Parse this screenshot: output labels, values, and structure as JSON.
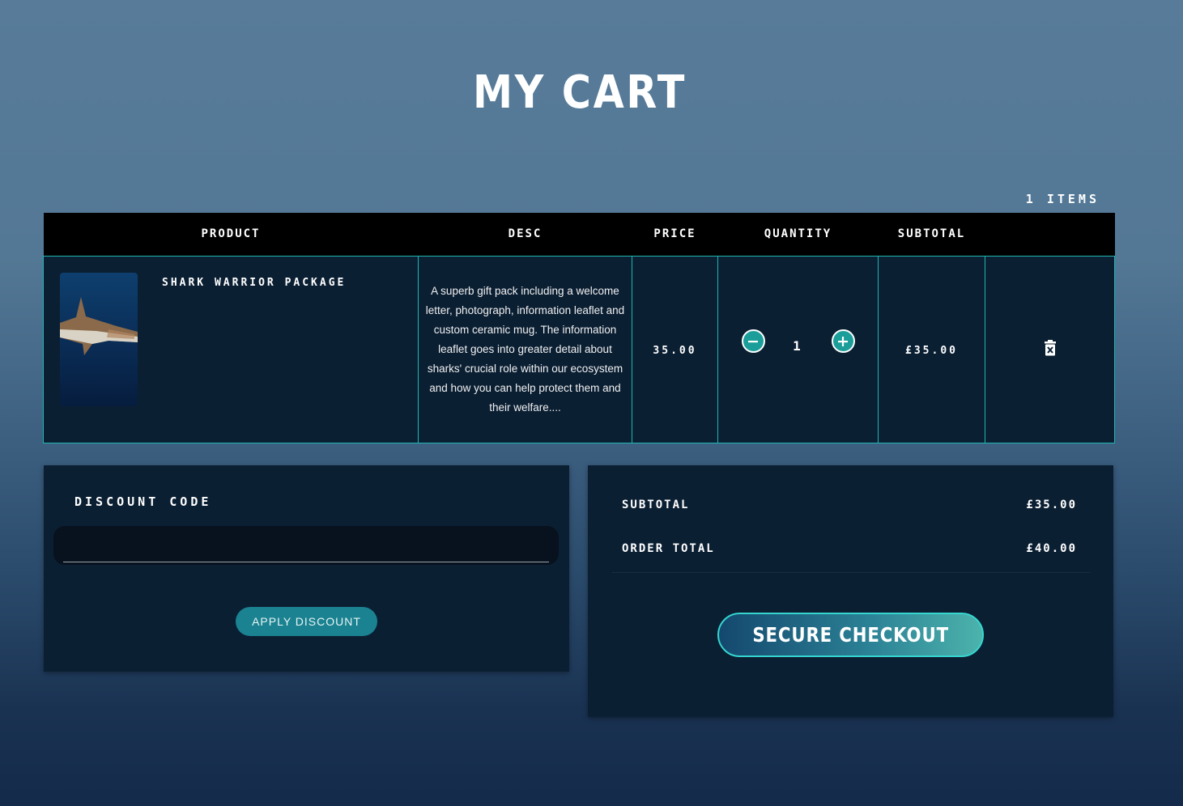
{
  "page": {
    "title": "MY CART",
    "items_count": "1 ITEMS"
  },
  "table": {
    "headers": [
      "PRODUCT",
      "DESC",
      "PRICE",
      "QUANTITY",
      "SUBTOTAL",
      ""
    ],
    "rows": [
      {
        "product_name": "SHARK WARRIOR PACKAGE",
        "image_icon": "shark-product-image",
        "description": "A superb gift pack including a welcome letter, photograph, information leaflet and custom ceramic mug. The information leaflet goes into greater detail about sharks' crucial role within our ecosystem and how you can help protect them and their welfare....",
        "price": "35.00",
        "quantity": "1",
        "subtotal": "£35.00",
        "remove_icon": "trash-icon"
      }
    ]
  },
  "discount": {
    "label": "DISCOUNT CODE",
    "input_value": "",
    "placeholder": "",
    "apply_label": "APPLY DISCOUNT"
  },
  "summary": {
    "subtotal_label": "SUBTOTAL",
    "subtotal_value": "£35.00",
    "order_total_label": "ORDER TOTAL",
    "order_total_value": "£40.00",
    "checkout_label": "SECURE CHECKOUT"
  },
  "colors": {
    "accent": "#1fb5b0",
    "panel_bg": "#0b1f33",
    "header_bg": "#000000",
    "button_teal": "#1a8290"
  }
}
